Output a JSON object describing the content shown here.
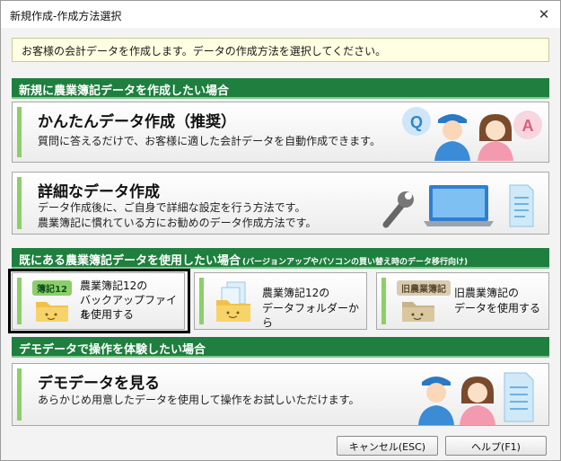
{
  "window": {
    "title": "新規作成-作成方法選択"
  },
  "notice": "お客様の会計データを作成します。データの作成方法を選択してください。",
  "sections": {
    "new": "新規に農業簿記データを作成したい場合",
    "existing": "既にある農業簿記データを使用したい場合",
    "existing_sub": "(バージョンアップやパソコンの買い替え時のデータ移行向け)",
    "demo": "デモデータで操作を体験したい場合"
  },
  "cards": {
    "easy": {
      "title": "かんたんデータ作成（推奨）",
      "desc": "質問に答えるだけで、お客様に適した会計データを自動作成できます。"
    },
    "detail": {
      "title": "詳細なデータ作成",
      "desc1": "データ作成後に、ご自身で詳細な設定を行う方法です。",
      "desc2": "農業簿記に慣れている方にお勧めのデータ作成方法です。"
    },
    "demo": {
      "title": "デモデータを見る",
      "desc": "あらかじめ用意したデータを使用して操作をお試しいただけます。"
    }
  },
  "small_cards": {
    "backup": {
      "badge": "簿記12",
      "line1": "農業簿記12の",
      "line2": "バックアップファイル",
      "line3": "を使用する"
    },
    "folder": {
      "line1": "農業簿記12の",
      "line2": "データフォルダーから"
    },
    "old": {
      "badge": "旧農業簿記",
      "line1": "旧農業簿記の",
      "line2": "データを使用する"
    }
  },
  "illustration": {
    "q": "Q",
    "a": "A"
  },
  "buttons": {
    "cancel": "キャンセル(ESC)",
    "help": "ヘルプ(F1)"
  },
  "colors": {
    "section_green": "#1e7f3e",
    "card_accent": "#8ccf6a",
    "notice_bg": "#ffffe1"
  }
}
